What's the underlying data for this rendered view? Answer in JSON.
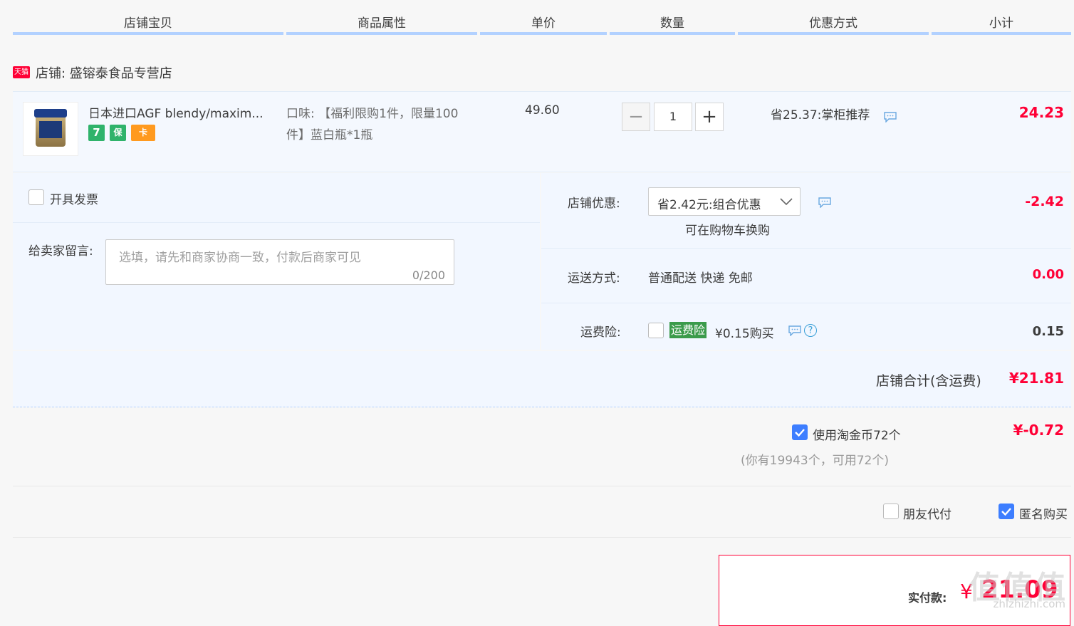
{
  "header": {
    "columns": [
      "店铺宝贝",
      "商品属性",
      "单价",
      "数量",
      "优惠方式",
      "小计"
    ]
  },
  "shop": {
    "icon_text": "天猫",
    "label": "店铺: 盛镕泰食品专营店"
  },
  "item": {
    "title": "日本进口AGF blendy/maxim...",
    "badges": [
      "7",
      "保",
      "卡"
    ],
    "attr_line1": "口味: 【福利限购1件，限量100",
    "attr_line2": "件】蓝白瓶*1瓶",
    "price": "49.60",
    "quantity": "1",
    "minus": "−",
    "plus": "+",
    "promo": "省25.37:掌柜推荐",
    "subtotal": "24.23"
  },
  "invoice": {
    "label": "开具发票"
  },
  "message": {
    "label": "给卖家留言:",
    "placeholder": "选填，请先和商家协商一致，付款后商家可见",
    "count": "0/200"
  },
  "shop_discount": {
    "label": "店铺优惠:",
    "selected": "省2.42元:组合优惠",
    "note": "可在购物车换购",
    "amount": "-2.42"
  },
  "shipping": {
    "label": "运送方式:",
    "value": "普通配送 快递 免邮",
    "amount": "0.00"
  },
  "insurance": {
    "label": "运费险:",
    "tag": "运费险",
    "price_text": "¥0.15购买",
    "amount": "0.15"
  },
  "shop_total": {
    "label": "店铺合计(含运费)",
    "amount": "¥21.81"
  },
  "coins": {
    "label": "使用淘金币72个",
    "amount": "¥-0.72",
    "note": "(你有19943个，可用72个)"
  },
  "options": {
    "friend_pay": "朋友代付",
    "anonymous": "匿名购买"
  },
  "payment": {
    "label": "实付款:",
    "currency": "¥",
    "amount": "21.09"
  },
  "watermark": {
    "text": "值值值",
    "sub": "zhizhizhi.com"
  },
  "colors": {
    "accent_red": "#ff0036",
    "header_line": "#b2d1ff",
    "check_blue": "#3d7eff",
    "insurance_green": "#3b9b4b"
  }
}
